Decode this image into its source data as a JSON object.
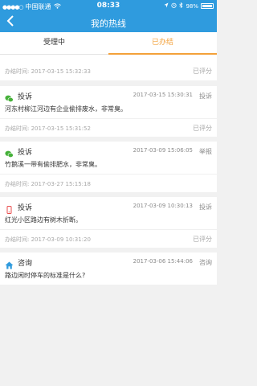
{
  "status": {
    "carrier": "中国联通",
    "time": "08:33",
    "battery": "98%"
  },
  "header": {
    "title": "我的热线",
    "back_icon": "chevron-left-icon"
  },
  "tabs": [
    {
      "label": "受理中"
    },
    {
      "label": "已办结"
    }
  ],
  "first_done": {
    "label": "办结时间:",
    "time": "2017-03-15 15:32:33",
    "rating": "已评分"
  },
  "records": [
    {
      "type": "投诉",
      "icon": "wechat-icon",
      "submit_time": "2017-03-15 15:30:31",
      "kind": "投诉",
      "text": "河东村柳江河边有企业偷排废水，非常臭。",
      "done_label": "办结时间:",
      "done_time": "2017-03-15 15:31:52",
      "rating": "已评分"
    },
    {
      "type": "投诉",
      "icon": "wechat-icon",
      "submit_time": "2017-03-09 15:06:05",
      "kind": "举报",
      "text": "竹鹅溪一带有偷排肥水，非常臭。",
      "done_label": "办结时间:",
      "done_time": "2017-03-27 15:15:18",
      "rating": ""
    },
    {
      "type": "投诉",
      "icon": "phone-icon",
      "submit_time": "2017-03-09 10:30:13",
      "kind": "投诉",
      "text": "红光小区路边有树木折断。",
      "done_label": "办结时间:",
      "done_time": "2017-03-09 10:31:20",
      "rating": "已评分"
    },
    {
      "type": "咨询",
      "icon": "home-icon",
      "submit_time": "2017-03-06 15:44:06",
      "kind": "咨询",
      "text": "路边闲时停车的标准是什么?",
      "done_label": "",
      "done_time": "",
      "rating": ""
    }
  ],
  "colors": {
    "primary": "#2f9bde",
    "accent": "#f3a13a",
    "wechat": "#46b13a",
    "phone": "#e94e4e"
  }
}
